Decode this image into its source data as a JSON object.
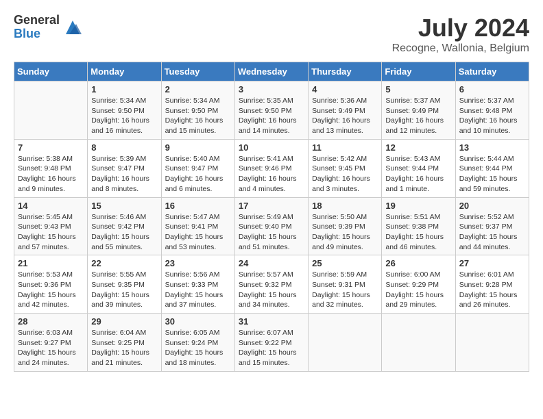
{
  "logo": {
    "general": "General",
    "blue": "Blue"
  },
  "title": "July 2024",
  "location": "Recogne, Wallonia, Belgium",
  "headers": [
    "Sunday",
    "Monday",
    "Tuesday",
    "Wednesday",
    "Thursday",
    "Friday",
    "Saturday"
  ],
  "weeks": [
    [
      {
        "day": "",
        "sunrise": "",
        "sunset": "",
        "daylight": ""
      },
      {
        "day": "1",
        "sunrise": "Sunrise: 5:34 AM",
        "sunset": "Sunset: 9:50 PM",
        "daylight": "Daylight: 16 hours and 16 minutes."
      },
      {
        "day": "2",
        "sunrise": "Sunrise: 5:34 AM",
        "sunset": "Sunset: 9:50 PM",
        "daylight": "Daylight: 16 hours and 15 minutes."
      },
      {
        "day": "3",
        "sunrise": "Sunrise: 5:35 AM",
        "sunset": "Sunset: 9:50 PM",
        "daylight": "Daylight: 16 hours and 14 minutes."
      },
      {
        "day": "4",
        "sunrise": "Sunrise: 5:36 AM",
        "sunset": "Sunset: 9:49 PM",
        "daylight": "Daylight: 16 hours and 13 minutes."
      },
      {
        "day": "5",
        "sunrise": "Sunrise: 5:37 AM",
        "sunset": "Sunset: 9:49 PM",
        "daylight": "Daylight: 16 hours and 12 minutes."
      },
      {
        "day": "6",
        "sunrise": "Sunrise: 5:37 AM",
        "sunset": "Sunset: 9:48 PM",
        "daylight": "Daylight: 16 hours and 10 minutes."
      }
    ],
    [
      {
        "day": "7",
        "sunrise": "Sunrise: 5:38 AM",
        "sunset": "Sunset: 9:48 PM",
        "daylight": "Daylight: 16 hours and 9 minutes."
      },
      {
        "day": "8",
        "sunrise": "Sunrise: 5:39 AM",
        "sunset": "Sunset: 9:47 PM",
        "daylight": "Daylight: 16 hours and 8 minutes."
      },
      {
        "day": "9",
        "sunrise": "Sunrise: 5:40 AM",
        "sunset": "Sunset: 9:47 PM",
        "daylight": "Daylight: 16 hours and 6 minutes."
      },
      {
        "day": "10",
        "sunrise": "Sunrise: 5:41 AM",
        "sunset": "Sunset: 9:46 PM",
        "daylight": "Daylight: 16 hours and 4 minutes."
      },
      {
        "day": "11",
        "sunrise": "Sunrise: 5:42 AM",
        "sunset": "Sunset: 9:45 PM",
        "daylight": "Daylight: 16 hours and 3 minutes."
      },
      {
        "day": "12",
        "sunrise": "Sunrise: 5:43 AM",
        "sunset": "Sunset: 9:44 PM",
        "daylight": "Daylight: 16 hours and 1 minute."
      },
      {
        "day": "13",
        "sunrise": "Sunrise: 5:44 AM",
        "sunset": "Sunset: 9:44 PM",
        "daylight": "Daylight: 15 hours and 59 minutes."
      }
    ],
    [
      {
        "day": "14",
        "sunrise": "Sunrise: 5:45 AM",
        "sunset": "Sunset: 9:43 PM",
        "daylight": "Daylight: 15 hours and 57 minutes."
      },
      {
        "day": "15",
        "sunrise": "Sunrise: 5:46 AM",
        "sunset": "Sunset: 9:42 PM",
        "daylight": "Daylight: 15 hours and 55 minutes."
      },
      {
        "day": "16",
        "sunrise": "Sunrise: 5:47 AM",
        "sunset": "Sunset: 9:41 PM",
        "daylight": "Daylight: 15 hours and 53 minutes."
      },
      {
        "day": "17",
        "sunrise": "Sunrise: 5:49 AM",
        "sunset": "Sunset: 9:40 PM",
        "daylight": "Daylight: 15 hours and 51 minutes."
      },
      {
        "day": "18",
        "sunrise": "Sunrise: 5:50 AM",
        "sunset": "Sunset: 9:39 PM",
        "daylight": "Daylight: 15 hours and 49 minutes."
      },
      {
        "day": "19",
        "sunrise": "Sunrise: 5:51 AM",
        "sunset": "Sunset: 9:38 PM",
        "daylight": "Daylight: 15 hours and 46 minutes."
      },
      {
        "day": "20",
        "sunrise": "Sunrise: 5:52 AM",
        "sunset": "Sunset: 9:37 PM",
        "daylight": "Daylight: 15 hours and 44 minutes."
      }
    ],
    [
      {
        "day": "21",
        "sunrise": "Sunrise: 5:53 AM",
        "sunset": "Sunset: 9:36 PM",
        "daylight": "Daylight: 15 hours and 42 minutes."
      },
      {
        "day": "22",
        "sunrise": "Sunrise: 5:55 AM",
        "sunset": "Sunset: 9:35 PM",
        "daylight": "Daylight: 15 hours and 39 minutes."
      },
      {
        "day": "23",
        "sunrise": "Sunrise: 5:56 AM",
        "sunset": "Sunset: 9:33 PM",
        "daylight": "Daylight: 15 hours and 37 minutes."
      },
      {
        "day": "24",
        "sunrise": "Sunrise: 5:57 AM",
        "sunset": "Sunset: 9:32 PM",
        "daylight": "Daylight: 15 hours and 34 minutes."
      },
      {
        "day": "25",
        "sunrise": "Sunrise: 5:59 AM",
        "sunset": "Sunset: 9:31 PM",
        "daylight": "Daylight: 15 hours and 32 minutes."
      },
      {
        "day": "26",
        "sunrise": "Sunrise: 6:00 AM",
        "sunset": "Sunset: 9:29 PM",
        "daylight": "Daylight: 15 hours and 29 minutes."
      },
      {
        "day": "27",
        "sunrise": "Sunrise: 6:01 AM",
        "sunset": "Sunset: 9:28 PM",
        "daylight": "Daylight: 15 hours and 26 minutes."
      }
    ],
    [
      {
        "day": "28",
        "sunrise": "Sunrise: 6:03 AM",
        "sunset": "Sunset: 9:27 PM",
        "daylight": "Daylight: 15 hours and 24 minutes."
      },
      {
        "day": "29",
        "sunrise": "Sunrise: 6:04 AM",
        "sunset": "Sunset: 9:25 PM",
        "daylight": "Daylight: 15 hours and 21 minutes."
      },
      {
        "day": "30",
        "sunrise": "Sunrise: 6:05 AM",
        "sunset": "Sunset: 9:24 PM",
        "daylight": "Daylight: 15 hours and 18 minutes."
      },
      {
        "day": "31",
        "sunrise": "Sunrise: 6:07 AM",
        "sunset": "Sunset: 9:22 PM",
        "daylight": "Daylight: 15 hours and 15 minutes."
      },
      {
        "day": "",
        "sunrise": "",
        "sunset": "",
        "daylight": ""
      },
      {
        "day": "",
        "sunrise": "",
        "sunset": "",
        "daylight": ""
      },
      {
        "day": "",
        "sunrise": "",
        "sunset": "",
        "daylight": ""
      }
    ]
  ]
}
